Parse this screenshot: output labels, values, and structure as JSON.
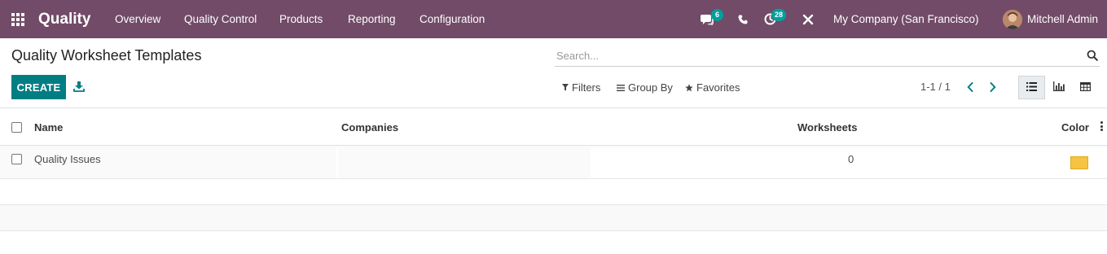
{
  "navbar": {
    "app_name": "Quality",
    "menu": [
      "Overview",
      "Quality Control",
      "Products",
      "Reporting",
      "Configuration"
    ],
    "messages_count": "6",
    "activities_count": "28",
    "company": "My Company (San Francisco)",
    "user": "Mitchell Admin"
  },
  "control_panel": {
    "title": "Quality Worksheet Templates",
    "search_placeholder": "Search...",
    "create_label": "CREATE",
    "filters_label": "Filters",
    "groupby_label": "Group By",
    "favorites_label": "Favorites",
    "pager": "1-1 / 1"
  },
  "list": {
    "columns": [
      "Name",
      "Companies",
      "Worksheets",
      "Color"
    ],
    "rows": [
      {
        "name": "Quality Issues",
        "companies": "",
        "worksheets": "0",
        "color": "#f6c342"
      }
    ]
  },
  "colors": {
    "navbar_bg": "#714b67",
    "primary": "#017e84",
    "badge": "#00a09d"
  }
}
